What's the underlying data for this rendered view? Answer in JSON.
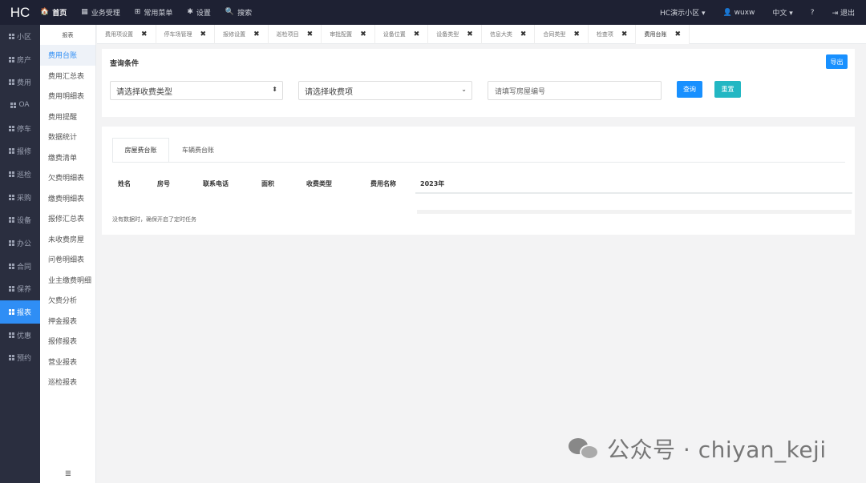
{
  "topbar": {
    "brand": "HC",
    "nav": [
      {
        "icon": "home-icon",
        "glyph": "🏠",
        "label": "首页"
      },
      {
        "icon": "calculator-icon",
        "glyph": "▦",
        "label": "业务受理"
      },
      {
        "icon": "sitemap-icon",
        "glyph": "⊞",
        "label": "常用菜单"
      },
      {
        "icon": "gear-icon",
        "glyph": "✱",
        "label": "设置"
      },
      {
        "icon": "search-icon",
        "glyph": "🔍",
        "label": "搜索"
      }
    ],
    "community": "HC演示小区",
    "user": "wuxw",
    "language": "中文",
    "help": "?",
    "logout": "退出"
  },
  "sidebar": {
    "items": [
      "小区",
      "房产",
      "费用",
      "OA",
      "停车",
      "报修",
      "巡检",
      "采购",
      "设备",
      "办公",
      "合同",
      "保养",
      "报表",
      "优惠",
      "预约"
    ],
    "active": "报表"
  },
  "submenu": {
    "title": "报表",
    "items": [
      "费用台账",
      "费用汇总表",
      "费用明细表",
      "费用提醒",
      "数据统计",
      "缴费清单",
      "欠费明细表",
      "缴费明细表",
      "报修汇总表",
      "未收费房屋",
      "问卷明细表",
      "业主缴费明细",
      "欠费分析",
      "押金报表",
      "报修报表",
      "营业报表",
      "巡检报表"
    ],
    "active": "费用台账",
    "collapse_glyph": "≣"
  },
  "tabs": {
    "items": [
      "费用项设置",
      "停车场管理",
      "报修设置",
      "巡检项目",
      "审批配置",
      "设备位置",
      "设备类型",
      "信息大类",
      "合同类型",
      "检查项",
      "费用台账"
    ],
    "close_glyph": "✖"
  },
  "query": {
    "title": "查询条件",
    "export_label": "导出",
    "fee_type_placeholder": "请选择收费类型",
    "fee_item_placeholder": "请选择收费项",
    "room_placeholder": "请填写房屋编号",
    "query_label": "查询",
    "reset_label": "重置"
  },
  "ledger": {
    "tabs": [
      "房屋费台账",
      "车辆费台账"
    ],
    "active_tab": "房屋费台账",
    "columns": [
      "姓名",
      "房号",
      "联系电话",
      "面积",
      "收费类型",
      "费用名称",
      "2023年"
    ],
    "empty_text": "没有数据时，确保开启了定时任务"
  },
  "watermark": {
    "text": "公众号 · chiyan_keji"
  }
}
